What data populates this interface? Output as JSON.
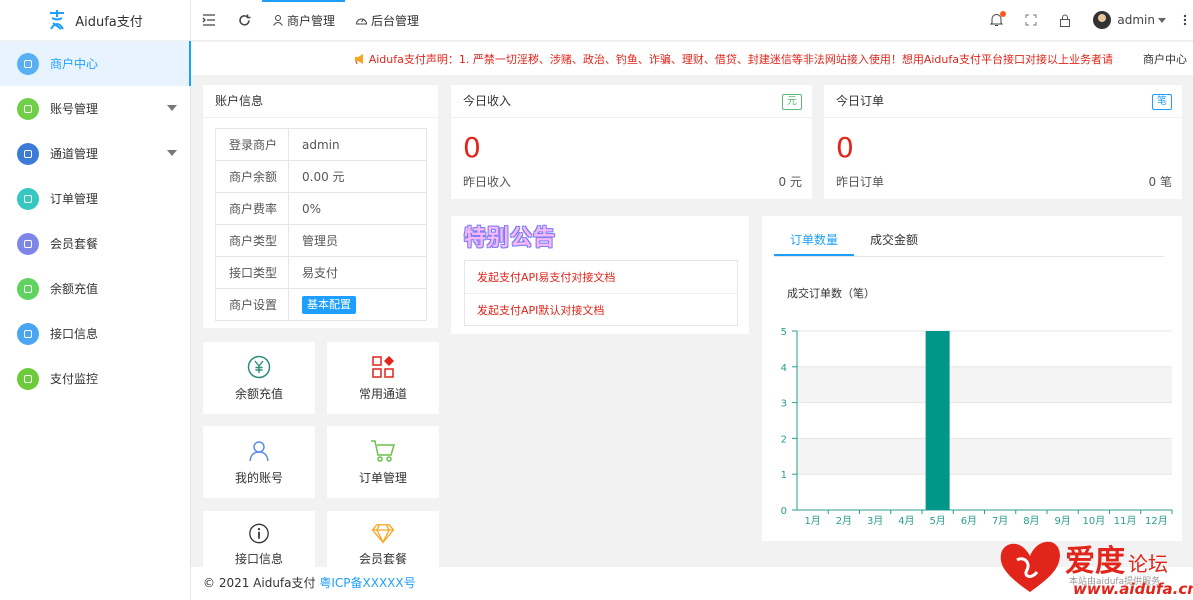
{
  "brand": {
    "name": "Aidufa支付"
  },
  "sidebar": {
    "items": [
      {
        "label": "商户中心",
        "color": "#5ab0f5",
        "active": true,
        "arrow": false
      },
      {
        "label": "账号管理",
        "color": "#6fcf46",
        "active": false,
        "arrow": true
      },
      {
        "label": "通道管理",
        "color": "#3d7bd8",
        "active": false,
        "arrow": true
      },
      {
        "label": "订单管理",
        "color": "#36c7c1",
        "active": false,
        "arrow": false
      },
      {
        "label": "会员套餐",
        "color": "#7e86e8",
        "active": false,
        "arrow": false
      },
      {
        "label": "余额充值",
        "color": "#5fd35f",
        "active": false,
        "arrow": false
      },
      {
        "label": "接口信息",
        "color": "#4aa6f2",
        "active": false,
        "arrow": false
      },
      {
        "label": "支付监控",
        "color": "#6ccb3b",
        "active": false,
        "arrow": false
      }
    ]
  },
  "header": {
    "tabs": [
      {
        "label": "商户管理"
      },
      {
        "label": "后台管理"
      }
    ],
    "user": "admin"
  },
  "notice": {
    "text": "Aidufa支付声明：1. 严禁一切淫秽、涉赌、政治、钓鱼、诈骗、理财、借贷、封建迷信等非法网站接入使用！想用Aidufa支付平台接口对接以上业务者请",
    "tail": "商户中心"
  },
  "account": {
    "title": "账户信息",
    "rows": [
      {
        "k": "登录商户",
        "v": "admin"
      },
      {
        "k": "商户余额",
        "v": "0.00 元"
      },
      {
        "k": "商户费率",
        "v": "0%"
      },
      {
        "k": "商户类型",
        "v": "管理员"
      },
      {
        "k": "接口类型",
        "v": "易支付"
      },
      {
        "k": "商户设置",
        "v": ""
      }
    ],
    "config_button": "基本配置"
  },
  "tiles": [
    {
      "label": "余额充值"
    },
    {
      "label": "常用通道"
    },
    {
      "label": "我的账号"
    },
    {
      "label": "订单管理"
    },
    {
      "label": "接口信息"
    },
    {
      "label": "会员套餐"
    }
  ],
  "income": {
    "title": "今日收入",
    "tag": "元",
    "value": "0",
    "yesterday_label": "昨日收入",
    "yesterday_value": "0 元"
  },
  "orders": {
    "title": "今日订单",
    "tag": "笔",
    "value": "0",
    "yesterday_label": "昨日订单",
    "yesterday_value": "0 笔"
  },
  "special": {
    "title": "特别公告",
    "links": [
      "发起支付API易支付对接文档",
      "发起支付API默认对接文档"
    ]
  },
  "chart_tabs": [
    "订单数量",
    "成交金额"
  ],
  "chart_data": {
    "type": "bar",
    "title": "成交订单数（笔）",
    "categories": [
      "1月",
      "2月",
      "3月",
      "4月",
      "5月",
      "6月",
      "7月",
      "8月",
      "9月",
      "10月",
      "11月",
      "12月"
    ],
    "values": [
      0,
      0,
      0,
      0,
      5,
      0,
      0,
      0,
      0,
      0,
      0,
      0
    ],
    "ylim": [
      0,
      5
    ],
    "yticks": [
      0,
      1,
      2,
      3,
      4,
      5
    ],
    "color": "#009688",
    "axis_color": "#2a9d8f"
  },
  "footer": {
    "copyright": "© 2021 Aidufa支付",
    "icp": "粤ICP备XXXXX号"
  },
  "watermark": {
    "text1": "爱度",
    "text2": "论坛",
    "text3": "www.aidufa.cn",
    "small": "本站由aidufa提供服务"
  }
}
